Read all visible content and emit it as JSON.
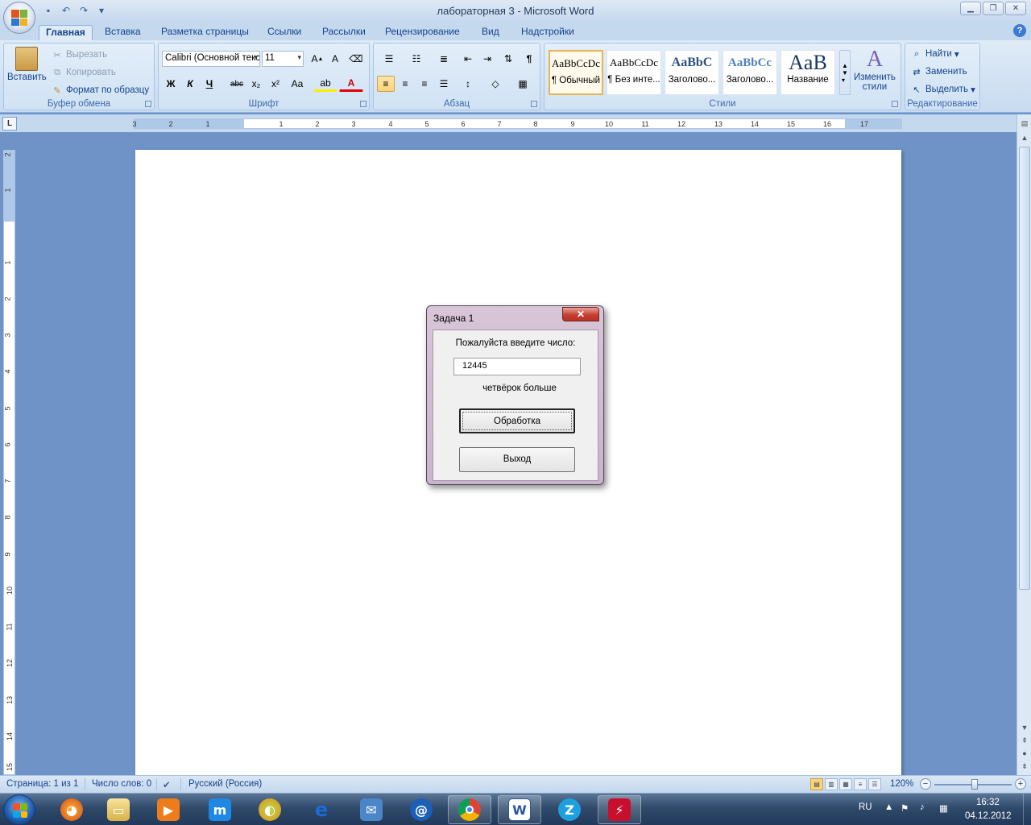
{
  "window": {
    "title": "лабораторная 3 - Microsoft Word",
    "qat_icons": [
      "save-icon",
      "undo-icon",
      "redo-icon",
      "customize-icon"
    ],
    "controls": [
      "minimize",
      "maximize",
      "close"
    ]
  },
  "ribbon": {
    "tabs": [
      {
        "label": "Главная",
        "active": true
      },
      {
        "label": "Вставка"
      },
      {
        "label": "Разметка страницы"
      },
      {
        "label": "Ссылки"
      },
      {
        "label": "Рассылки"
      },
      {
        "label": "Рецензирование"
      },
      {
        "label": "Вид"
      },
      {
        "label": "Надстройки"
      }
    ],
    "clipboard": {
      "label": "Буфер обмена",
      "paste": "Вставить",
      "cut": "Вырезать",
      "copy": "Копировать",
      "format_painter": "Формат по образцу"
    },
    "font": {
      "label": "Шрифт",
      "font_name": "Calibri (Основной текст)",
      "font_size": "11",
      "bold": "Ж",
      "italic": "К",
      "underline": "Ч",
      "strike": "abc",
      "subscript": "x₂",
      "superscript": "x²",
      "change_case": "Aa"
    },
    "paragraph": {
      "label": "Абзац",
      "show_marks": "¶"
    },
    "styles": {
      "label": "Стили",
      "items": [
        {
          "preview": "AaBbCcDc",
          "name": "¶ Обычный",
          "selected": true
        },
        {
          "preview": "AaBbCcDc",
          "name": "¶ Без инте..."
        },
        {
          "preview": "AaBbC",
          "name": "Заголово..."
        },
        {
          "preview": "AaBbCc",
          "name": "Заголово..."
        },
        {
          "preview": "AaB",
          "name": "Название"
        }
      ],
      "change_styles_line1": "Изменить",
      "change_styles_line2": "стили"
    },
    "editing": {
      "label": "Редактирование",
      "find": "Найти",
      "replace": "Заменить",
      "select": "Выделить"
    }
  },
  "ruler": {
    "tab_selector": "L",
    "horizontal_ticks": [
      "3",
      "2",
      "1",
      "1",
      "2",
      "3",
      "4",
      "5",
      "6",
      "7",
      "8",
      "9",
      "10",
      "11",
      "12",
      "13",
      "14",
      "15",
      "16",
      "17"
    ],
    "vertical_ticks": [
      "2",
      "1",
      "1",
      "2",
      "3",
      "4",
      "5",
      "6",
      "7",
      "8",
      "9",
      "10",
      "11",
      "12",
      "13",
      "14",
      "15"
    ]
  },
  "dialog": {
    "title": "Задача 1",
    "prompt": "Пожалуйста введите число:",
    "input_value": "12445",
    "result": "четвёрок больше",
    "process_button": "Обработка",
    "exit_button": "Выход"
  },
  "statusbar": {
    "page": "Страница: 1 из 1",
    "words": "Число слов: 0",
    "language": "Русский (Россия)",
    "zoom": "120%",
    "zoom_level_percent": 120
  },
  "taskbar": {
    "apps": [
      "firefox-icon",
      "explorer-folder-icon",
      "media-player-icon",
      "messenger-icon",
      "winamp-icon",
      "ie-icon",
      "mail-icon",
      "mail-ru-icon",
      "chrome-icon",
      "word-icon",
      "z-app-icon",
      "acrobat-icon"
    ],
    "language": "RU",
    "time": "16:32",
    "date": "04.12.2012"
  },
  "colors": {
    "accent": "#15428b",
    "ribbon_bg": "#dfebf7",
    "workspace": "#6f93c6",
    "close_button": "#c63f30"
  }
}
